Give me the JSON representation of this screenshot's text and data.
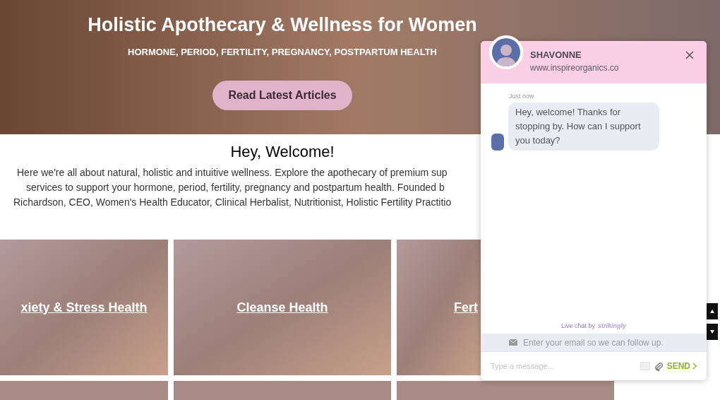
{
  "hero": {
    "title": "Holistic Apothecary & Wellness for Women",
    "subtitle": "HORMONE, PERIOD, FERTILITY, PREGNANCY, POSTPARTUM HEALTH",
    "button": "Read Latest Articles"
  },
  "welcome": {
    "heading": "Hey, Welcome!",
    "lines": [
      "Here we're all about natural, holistic and intuitive wellness. Explore the apothecary of premium sup",
      "services to support your hormone, period, fertility, pregnancy and postpartum health. Founded b",
      "Richardson, CEO, Women's Health Educator, Clinical Herbalist, Nutritionist, Holistic Fertility Practitio"
    ]
  },
  "tiles": [
    {
      "label": "xiety & Stress Health"
    },
    {
      "label": "Cleanse Health"
    },
    {
      "label": "Fert"
    }
  ],
  "chat": {
    "name": "SHAVONNE",
    "site": "www.inspireorganics.co",
    "messages": [
      {
        "time": "Just now",
        "text": "Hey, welcome! Thanks for stopping by. How can I support you today?"
      }
    ],
    "powered_by": "Live chat by",
    "brand": "strikingly",
    "email_placeholder": "Enter your email so we can follow up.",
    "message_placeholder": "Type a message...",
    "send": "SEND"
  }
}
